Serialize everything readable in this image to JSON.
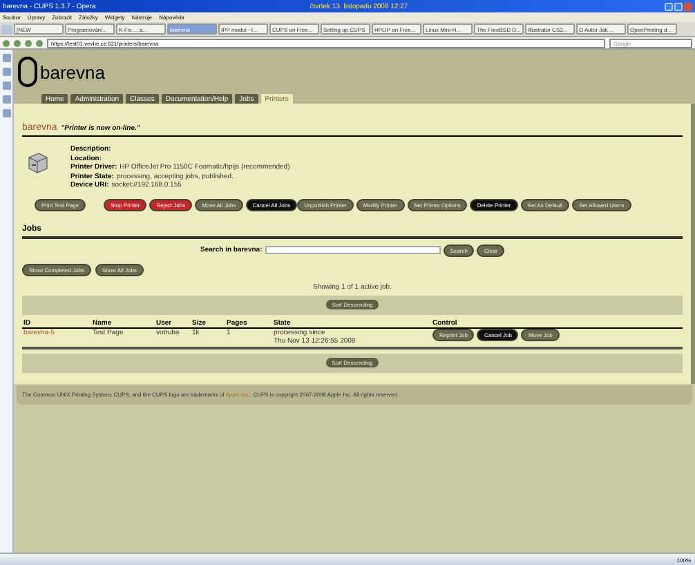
{
  "browser": {
    "title": "barevna - CUPS 1.3.7 - Opera",
    "clock": "čtvrtek 13. listopadu 2008 12:27",
    "menu": [
      "Soubor",
      "Úpravy",
      "Zobrazit",
      "Záložky",
      "Widgety",
      "Nástroje",
      "Nápověda"
    ],
    "tabs": [
      {
        "label": "[NEW",
        "selected": false
      },
      {
        "label": "Programování...",
        "selected": false
      },
      {
        "label": "K-Fix ... a...",
        "selected": false
      },
      {
        "label": "barevna",
        "selected": true
      },
      {
        "label": "IPP modul - t...",
        "selected": false
      },
      {
        "label": "CUPS on Free...",
        "selected": false
      },
      {
        "label": "Setting up CUPS",
        "selected": false
      },
      {
        "label": "HPLIP on Free...",
        "selected": false
      },
      {
        "label": "Linux Mini-H...",
        "selected": false
      },
      {
        "label": "The FreeBSD D...",
        "selected": false
      },
      {
        "label": "Illustrator CS3...",
        "selected": false
      },
      {
        "label": "O Autor Jak ...",
        "selected": false
      },
      {
        "label": "OpenPrinting d...",
        "selected": false
      }
    ],
    "address": "https://test01.vevhe.cz:631/printers/barevna",
    "search_placeholder": "Google"
  },
  "header": {
    "printer": "barevna",
    "nav": [
      {
        "label": "Home",
        "selected": false
      },
      {
        "label": "Administration",
        "selected": false
      },
      {
        "label": "Classes",
        "selected": false
      },
      {
        "label": "Documentation/Help",
        "selected": false
      },
      {
        "label": "Jobs",
        "selected": false
      },
      {
        "label": "Printers",
        "selected": true
      }
    ]
  },
  "message": {
    "printer": "barevna",
    "text": "\"Printer is now on-line.\""
  },
  "details": [
    {
      "label": "Description:"
    },
    {
      "label": "Location:"
    },
    {
      "label": "Printer Driver:",
      "value": "HP OfficeJet Pro 1150C Foomatic/hpijs (recommended)"
    },
    {
      "label": "Printer State:",
      "value": "processing, accepting jobs, published."
    },
    {
      "label": "Device URI:",
      "value": "socket://192.168.0.155"
    }
  ],
  "printer_buttons": [
    {
      "label": "Print Test Page",
      "kind": "normal"
    },
    {
      "label": "Stop Printer",
      "kind": "red"
    },
    {
      "label": "Reject Jobs",
      "kind": "red"
    },
    {
      "label": "Move All Jobs",
      "kind": "normal"
    },
    {
      "label": "Cancel All Jobs",
      "kind": "black"
    }
  ],
  "admin_buttons": [
    {
      "label": "Unpublish Printer",
      "kind": "normal"
    },
    {
      "label": "Modify Printer",
      "kind": "normal"
    },
    {
      "label": "Set Printer Options",
      "kind": "normal"
    },
    {
      "label": "Delete Printer",
      "kind": "black"
    },
    {
      "label": "Set As Default",
      "kind": "normal"
    },
    {
      "label": "Set Allowed Users",
      "kind": "normal"
    }
  ],
  "jobs": {
    "heading": "Jobs",
    "search_label": "Search in barevna:",
    "search_button": "Search",
    "clear_button": "Clear",
    "filter_buttons": [
      "Show Completed Jobs",
      "Show All Jobs"
    ],
    "summary": "Showing 1 of 1 active job.",
    "sort_buttons": [
      "Sort Descending",
      "Sort Descending"
    ],
    "columns": [
      "ID",
      "Name",
      "User",
      "Size",
      "Pages",
      "State",
      "Control"
    ],
    "rows": [
      {
        "id": "barevna-5",
        "name": "Test Page",
        "user": "votruba",
        "size": "1k",
        "pages": "1",
        "state": [
          "processing since",
          "Thu Nov 13 12:26:55 2008"
        ],
        "controls": [
          {
            "label": "Reprint Job",
            "kind": "normal"
          },
          {
            "label": "Cancel Job",
            "kind": "black"
          },
          {
            "label": "Move Job",
            "kind": "normal"
          }
        ]
      }
    ]
  },
  "footer": {
    "before": "The Common UNIX Printing System, CUPS, and the CUPS logo are trademarks of",
    "link": "Apple Inc.",
    "after": ". CUPS is copyright 2007-2008 Apple Inc. All rights reserved."
  },
  "status_bar": {
    "zoom": "100%"
  }
}
